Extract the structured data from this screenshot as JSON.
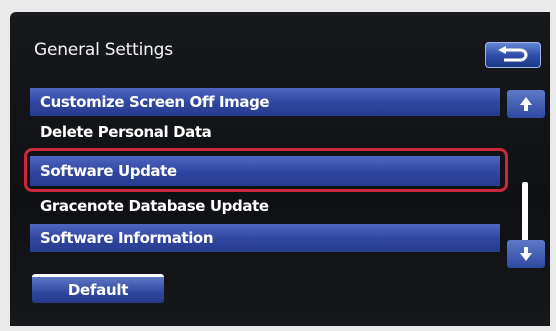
{
  "header": {
    "title": "General Settings",
    "back_icon": "return-arrow-icon"
  },
  "list": {
    "items": [
      {
        "label": "Customize Screen Off Image",
        "highlighted": true
      },
      {
        "label": "Delete Personal Data",
        "highlighted": false
      },
      {
        "label": "Software Update",
        "highlighted": true,
        "selected": true
      },
      {
        "label": "Gracenote Database Update",
        "highlighted": false
      },
      {
        "label": "Software Information",
        "highlighted": true
      }
    ]
  },
  "footer": {
    "default_label": "Default"
  },
  "colors": {
    "accent_blue": "#2f46a0",
    "selection_ring": "#c8283a",
    "background": "#0e1013"
  },
  "icons": {
    "scroll_up": "scroll-up-arrow-icon",
    "scroll_down": "scroll-down-arrow-icon"
  }
}
